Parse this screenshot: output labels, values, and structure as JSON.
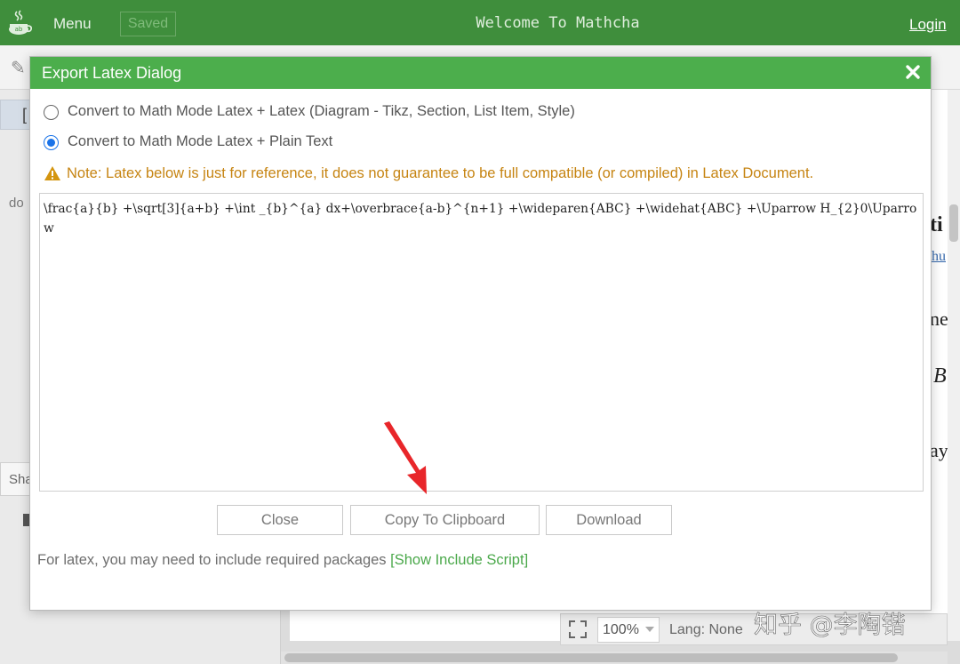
{
  "app": {
    "menu_label": "Menu",
    "saved_label": "Saved",
    "title": "Welcome To Mathcha",
    "login_label": "Login"
  },
  "background": {
    "left_fragment_doc": "do",
    "left_fragment_share": "Sha",
    "right_fragments": [
      "ti",
      "hu",
      "ne",
      "B",
      "ay"
    ],
    "zoom_value": "100%",
    "lang_text": "Lang: None"
  },
  "dialog": {
    "title": "Export Latex Dialog",
    "options": [
      {
        "label": "Convert to Math Mode Latex + Latex (Diagram - Tikz, Section, List Item, Style)",
        "checked": false
      },
      {
        "label": "Convert to Math Mode Latex + Plain Text",
        "checked": true
      }
    ],
    "warning": "Note: Latex below is just for reference, it does not guarantee to be full compatible (or compiled) in Latex Document.",
    "latex_output": "\\frac{a}{b} +\\sqrt[3]{a+b} +\\int _{b}^{a} dx+\\overbrace{a-b}^{n+1} +\\wideparen{ABC} +\\widehat{ABC} +\\Uparrow H_{2}0\\Uparrow",
    "buttons": {
      "close": "Close",
      "copy": "Copy To Clipboard",
      "download": "Download"
    },
    "footer_note": "For latex, you may need to include required packages",
    "show_script_label": "[Show Include Script]"
  },
  "watermark": "知乎 @李陶锴",
  "colors": {
    "app_bar": "#3f8e3c",
    "dialog_header": "#4cae4c",
    "warning": "#c68412",
    "link": "#4aa84a",
    "radio_checked": "#1a73e8",
    "arrow": "#e8262a"
  },
  "icons": [
    "mathcha-logo-icon",
    "close-icon",
    "warning-icon",
    "fullscreen-icon",
    "chevron-down-icon"
  ]
}
